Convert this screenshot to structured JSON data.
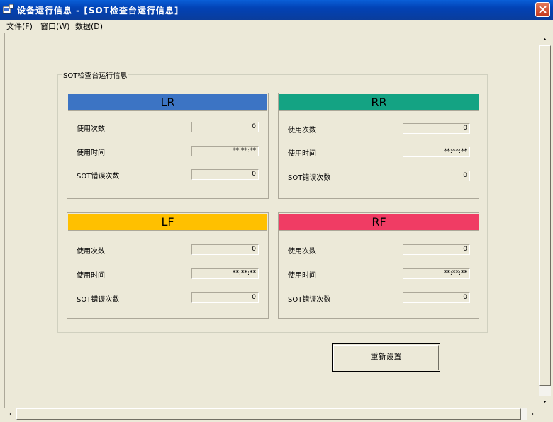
{
  "window": {
    "title": "设备运行信息 - [SOT检查台运行信息]"
  },
  "menu": {
    "items": [
      "文件(F)",
      "窗口(W)",
      "数据(D)"
    ]
  },
  "group": {
    "label": "SOT检查台运行信息"
  },
  "panels": [
    {
      "name": "LR",
      "color": "#3c74c4",
      "rows": [
        {
          "label": "使用次数",
          "value": "0"
        },
        {
          "label": "使用时间",
          "value": "**:**:**"
        },
        {
          "label": "SOT错误次数",
          "value": "0"
        }
      ]
    },
    {
      "name": "RR",
      "color": "#14a383",
      "rows": [
        {
          "label": "使用次数",
          "value": "0"
        },
        {
          "label": "使用时间",
          "value": "**:**:**"
        },
        {
          "label": "SOT错误次数",
          "value": "0"
        }
      ]
    },
    {
      "name": "LF",
      "color": "#ffc000",
      "rows": [
        {
          "label": "使用次数",
          "value": "0"
        },
        {
          "label": "使用时间",
          "value": "**:**:**"
        },
        {
          "label": "SOT错误次数",
          "value": "0"
        }
      ]
    },
    {
      "name": "RF",
      "color": "#f03c64",
      "rows": [
        {
          "label": "使用次数",
          "value": "0"
        },
        {
          "label": "使用时间",
          "value": "**:**:**"
        },
        {
          "label": "SOT错误次数",
          "value": "0"
        }
      ]
    }
  ],
  "buttons": {
    "reset_label": "重新设置"
  }
}
